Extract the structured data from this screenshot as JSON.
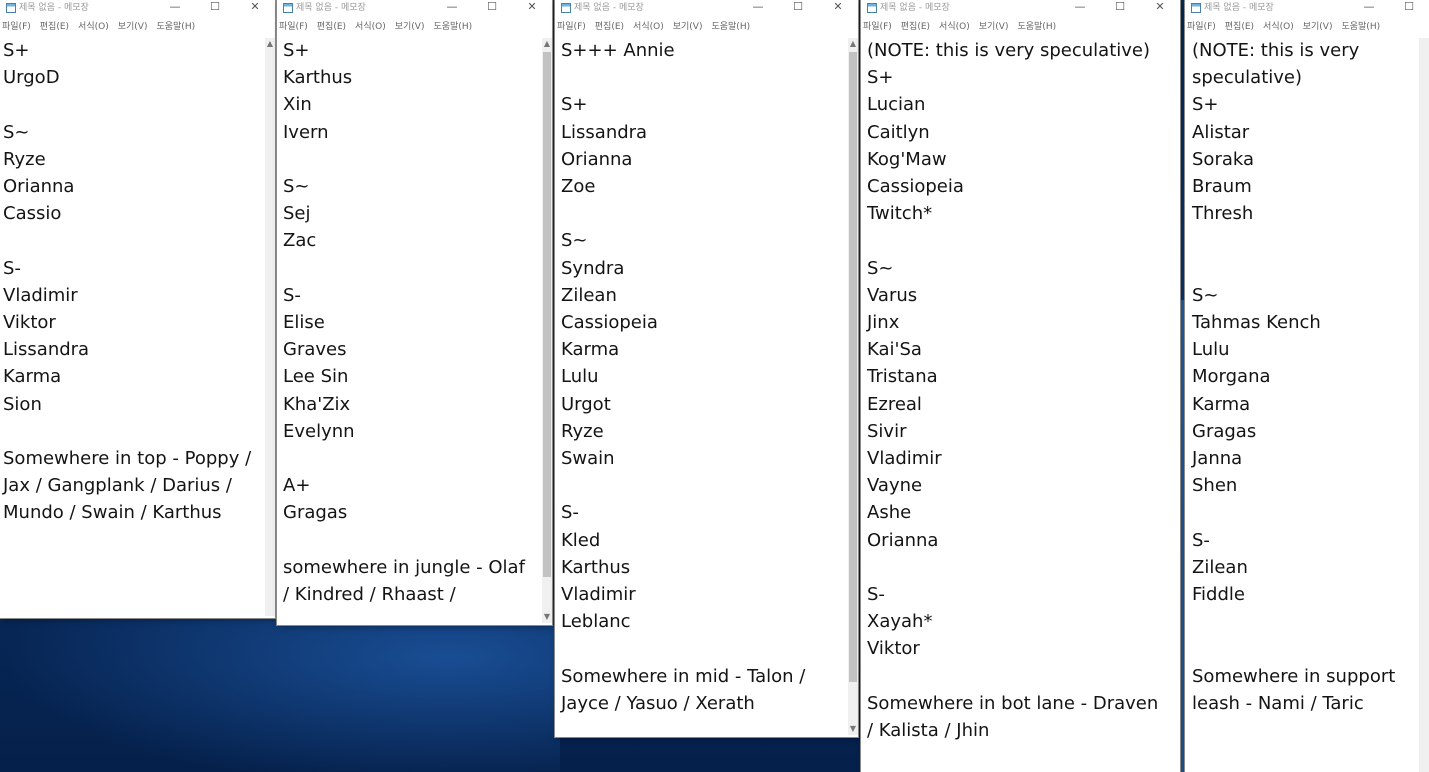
{
  "windows": [
    {
      "title": "제목 없음 - 메모장",
      "menu": [
        "파일(F)",
        "편집(E)",
        "서식(O)",
        "보기(V)",
        "도움말(H)"
      ],
      "controls": [
        "—",
        "☐",
        "✕"
      ],
      "text": "S+\nUrgoD\n\nS~\nRyze\nOrianna\nCassio\n\nS-\nVladimir\nViktor\nLissandra\nKarma\nSion\n\nSomewhere in top - Poppy / Jax / Gangplank / Darius / Mundo / Swain / Karthus"
    },
    {
      "title": "제목 없음 - 메모장",
      "menu": [
        "파일(F)",
        "편집(E)",
        "서식(O)",
        "보기(V)",
        "도움말(H)"
      ],
      "controls": [
        "—",
        "☐",
        "✕"
      ],
      "text": "S+\nKarthus\nXin\nIvern\n\nS~\nSej\nZac\n\nS-\nElise\nGraves\nLee Sin\nKha'Zix\nEvelynn\n\nA+\nGragas\n\nsomewhere in jungle - Olaf / Kindred / Rhaast /"
    },
    {
      "title": "제목 없음 - 메모장",
      "menu": [
        "파일(F)",
        "편집(E)",
        "서식(O)",
        "보기(V)",
        "도움말(H)"
      ],
      "controls": [
        "—",
        "☐",
        "✕"
      ],
      "text": "S+++ Annie\n\nS+\nLissandra\nOrianna\nZoe\n\nS~\nSyndra\nZilean\nCassiopeia\nKarma\nLulu\nUrgot\nRyze\nSwain\n\nS-\nKled\nKarthus\nVladimir\nLeblanc\n\nSomewhere in mid - Talon / Jayce / Yasuo / Xerath"
    },
    {
      "title": "제목 없음 - 메모장",
      "menu": [
        "파일(F)",
        "편집(E)",
        "서식(O)",
        "보기(V)",
        "도움말(H)"
      ],
      "controls": [
        "—",
        "☐",
        "✕"
      ],
      "text": "(NOTE: this is very speculative)\nS+\nLucian\nCaitlyn\nKog'Maw\nCassiopeia\nTwitch*\n\nS~\nVarus\nJinx\nKai'Sa\nTristana\nEzreal\nSivir\nVladimir\nVayne\nAshe\nOrianna\n\nS-\nXayah*\nViktor\n\nSomewhere in bot lane - Draven / Kalista / Jhin"
    },
    {
      "title": "제목 없음 - 메모장",
      "menu": [
        "파일(F)",
        "편집(E)",
        "서식(O)",
        "보기(V)",
        "도움말(H)"
      ],
      "controls": [
        "—",
        "☐"
      ],
      "text": "(NOTE: this is very speculative)\nS+\nAlistar\nSoraka\nBraum\nThresh\n\n\nS~\nTahmas Kench\nLulu\nMorgana\nKarma\nGragas\nJanna\nShen\n\nS-\nZilean\nFiddle\n\n\nSomewhere in support leash - Nami / Taric"
    }
  ]
}
